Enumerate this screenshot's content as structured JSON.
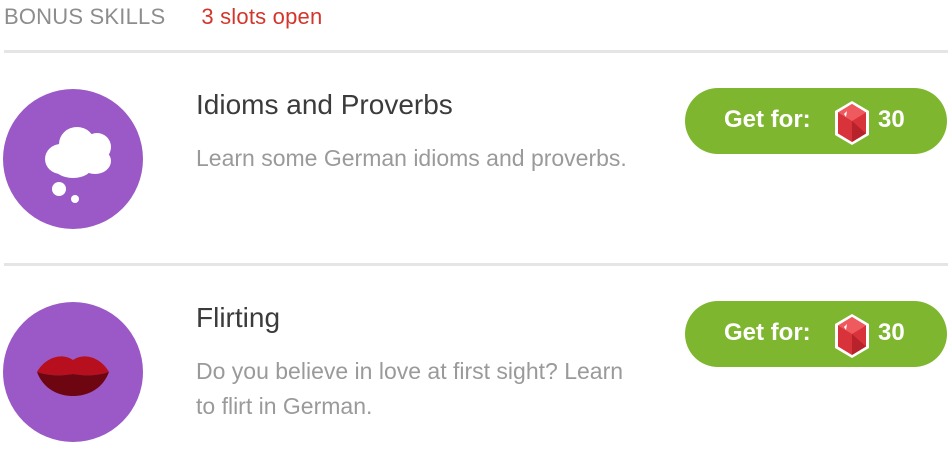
{
  "header": {
    "title": "BONUS SKILLS",
    "slots": "3 slots open"
  },
  "skills": [
    {
      "title": "Idioms and Proverbs",
      "description": "Learn some German idioms and proverbs.",
      "icon": "thought-bubble-icon",
      "button_label": "Get for:",
      "price": "30"
    },
    {
      "title": "Flirting",
      "description": "Do you believe in love at first sight? Learn to flirt in German.",
      "icon": "lips-icon",
      "button_label": "Get for:",
      "price": "30"
    }
  ],
  "colors": {
    "icon_background": "#9b59c8",
    "button": "#7eb72f",
    "slots_text": "#d3352b",
    "gem": "#d8333a"
  }
}
